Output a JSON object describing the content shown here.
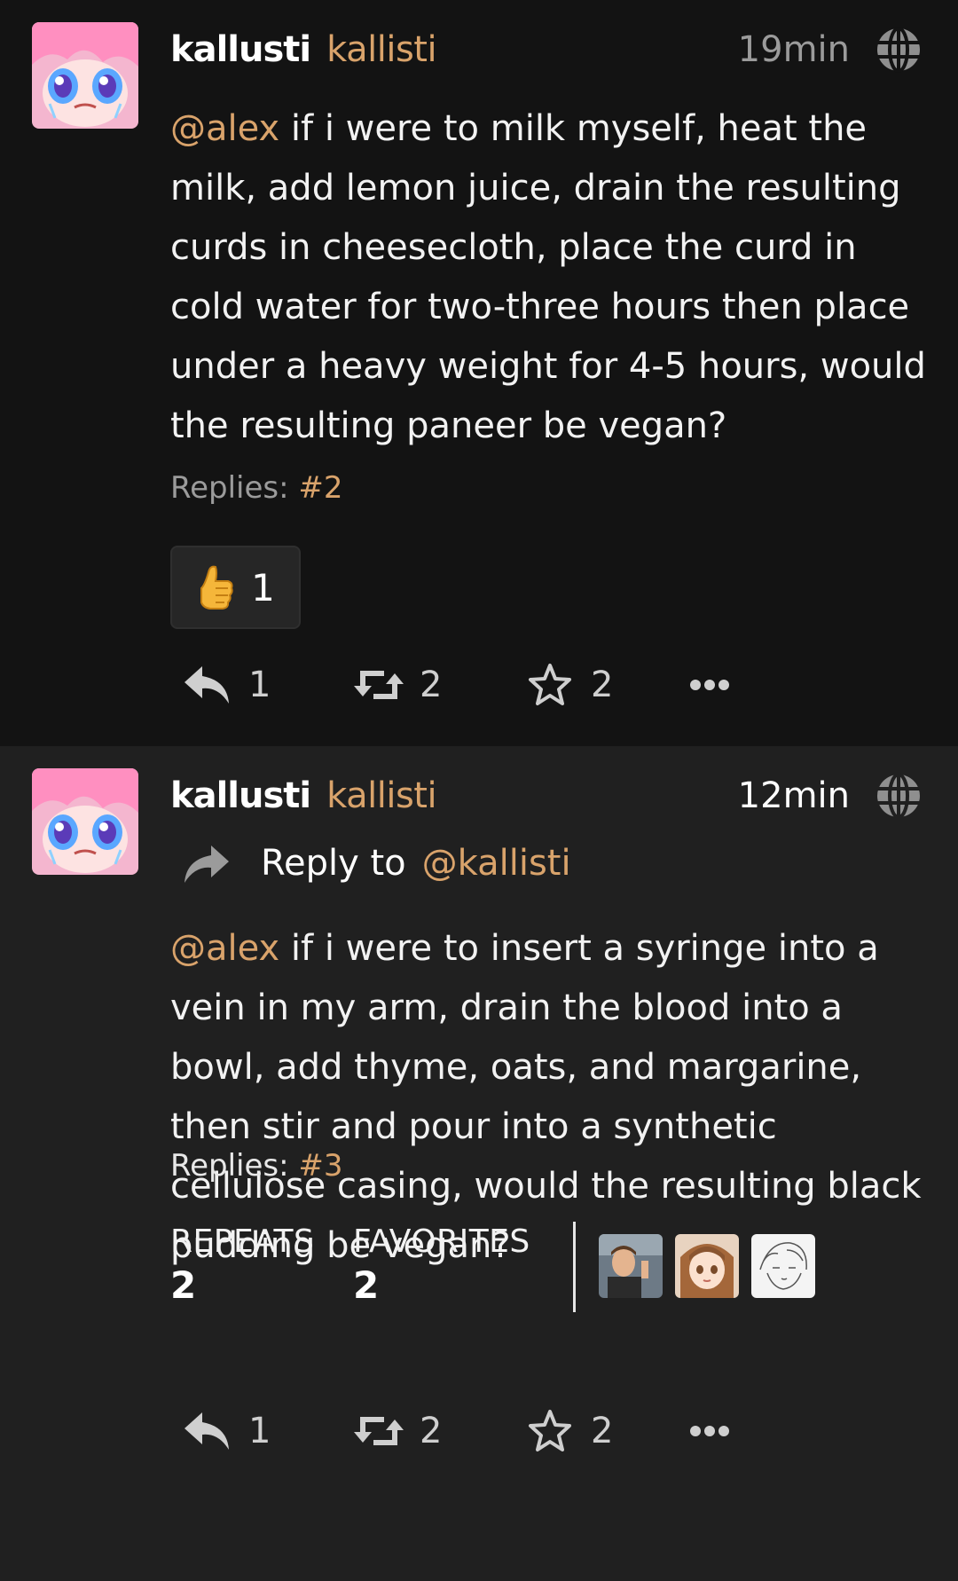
{
  "posts": [
    {
      "display_name": "kallusti",
      "acct": "kallisti",
      "time": "19min",
      "mention": "@alex",
      "body": " if i were to milk myself, heat the milk, add lemon juice, drain the resulting curds in cheesecloth, place the curd in cold water for two-three hours then place under a heavy weight for 4-5 hours, would the resulting paneer be vegan?",
      "replies_label": "Replies: ",
      "replies_link": "#2",
      "reaction": {
        "emoji": "thumbs-up",
        "count": "1"
      },
      "actions": {
        "reply_count": "1",
        "boost_count": "2",
        "fav_count": "2"
      }
    },
    {
      "display_name": "kallusti",
      "acct": "kallisti",
      "time": "12min",
      "reply_to_label": "Reply to",
      "reply_to_acct": "@kallisti",
      "mention": "@alex",
      "body": " if i were to insert a syringe into a vein in my arm, drain the blood into a bowl, add thyme, oats, and margarine, then stir and pour into a synthetic cellulose casing, would the resulting black pudding be vegan?",
      "replies_label": "Replies: ",
      "replies_link": "#3",
      "stats": {
        "repeats_label": "REPEATS",
        "repeats_value": "2",
        "favorites_label": "FAVORITES",
        "favorites_value": "2"
      },
      "actions": {
        "reply_count": "1",
        "boost_count": "2",
        "fav_count": "2"
      }
    }
  ],
  "colors": {
    "accent": "#d9a36b",
    "bg_post_1": "#131313",
    "bg_post_2": "#202020",
    "muted_text": "#9b9b9b"
  }
}
